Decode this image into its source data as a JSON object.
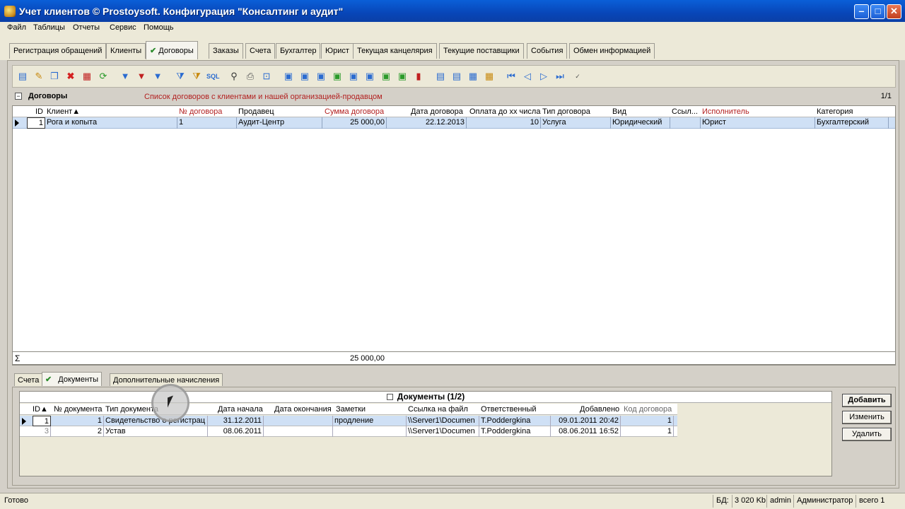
{
  "window": {
    "title": "Учет клиентов © Prostoysoft. Конфигурация \"Консалтинг и аудит\"",
    "minimize": "‒",
    "maximize": "□",
    "close": "✕"
  },
  "menu": [
    "Файл",
    "Таблицы",
    "Отчеты",
    "Сервис",
    "Помощь"
  ],
  "main_tabs": [
    "Регистрация обращений",
    "Клиенты",
    "Договоры",
    "Заказы",
    "Счета",
    "Бухгалтер",
    "Юрист",
    "Текущая канцелярия",
    "Текущие поставщики",
    "События",
    "Обмен информацией"
  ],
  "active_main_tab": "Договоры",
  "check_mark": "✔",
  "contracts": {
    "title": "Договоры",
    "description": "Список договоров с клиентами и нашей организацией-продавцом",
    "pages": "1/1",
    "columns": [
      "ID",
      "Клиент▲",
      "№ договора",
      "Продавец",
      "Сумма договора",
      "Дата договора",
      "Оплата до хх числа",
      "Тип договора",
      "Вид",
      "Ссыл...",
      "Исполнитель",
      "Категория"
    ],
    "rows": [
      {
        "id": "1",
        "client": "Рога и копыта",
        "number": "1",
        "seller": "Аудит-Центр",
        "sum": "25 000,00",
        "date": "22.12.2013",
        "pay_day": "10",
        "type": "Услуга",
        "kind": "Юридический",
        "link": "",
        "executor": "Юрист",
        "category": "Бухгалтерский"
      }
    ],
    "footer_sigma": "Σ",
    "footer_sum": "25 000,00"
  },
  "sub_tabs": [
    "Счета",
    "Документы",
    "Дополнительные начисления"
  ],
  "active_sub_tab": "Документы",
  "documents": {
    "title": "Документы (1/2)",
    "columns": [
      "ID▲",
      "№ документа",
      "Тип документа",
      "Дата начала",
      "Дата окончания",
      "Заметки",
      "Ссылка на файл",
      "Ответственный",
      "Добавлено",
      "Код договора"
    ],
    "rows": [
      {
        "id": "1",
        "doc_no": "1",
        "doc_type": "Свидетельство о регистрац",
        "start": "31.12.2011",
        "end": "",
        "notes": "продление",
        "file": "\\\\Server1\\Documen",
        "owner": "T.Poddergkina",
        "added": "09.01.2011 20:42",
        "contract": "1"
      },
      {
        "id": "3",
        "doc_no": "2",
        "doc_type": "Устав",
        "start": "08.06.2011",
        "end": "",
        "notes": "",
        "file": "\\\\Server1\\Documen",
        "owner": "T.Poddergkina",
        "added": "08.06.2011 16:52",
        "contract": "1"
      }
    ],
    "buttons": {
      "add": "Добавить",
      "edit": "Изменить",
      "delete": "Удалить"
    }
  },
  "status": {
    "ready": "Готово",
    "db_label": "БД:",
    "db_size": "3 020 Kb",
    "user": "admin",
    "role": "Администратор",
    "total": "всего 1"
  }
}
